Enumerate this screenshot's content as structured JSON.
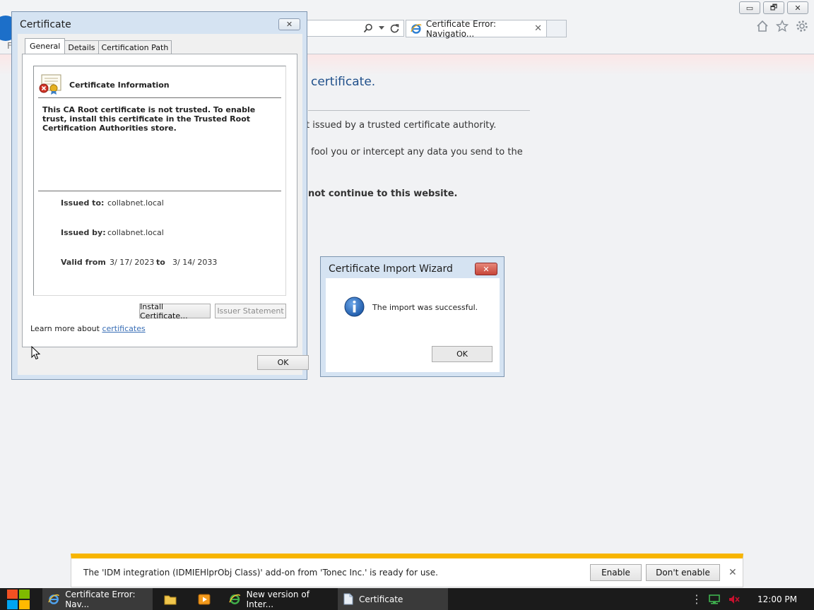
{
  "browser": {
    "active_tab_title": "Certificate Error: Navigatio...",
    "tab_close": "✕",
    "menu_stub": "F",
    "window_controls": {
      "minimize": "▭",
      "restore": "🗗",
      "close": "✕"
    },
    "toolbar_icons": [
      "home-icon",
      "star-icon",
      "gear-icon"
    ]
  },
  "error_page": {
    "title": "certificate.",
    "line1": "t issued by a trusted certificate authority.",
    "line2": "fool you or intercept any data you send to the",
    "line3": "not continue to this website."
  },
  "cert_dialog": {
    "title": "Certificate",
    "close_label": "✕",
    "tabs": [
      {
        "label": "General"
      },
      {
        "label": "Details"
      },
      {
        "label": "Certification Path"
      }
    ],
    "info_heading": "Certificate Information",
    "warning": "This CA Root certificate is not trusted. To enable trust, install this certificate in the Trusted Root Certification Authorities store.",
    "issued_to_label": "Issued to:",
    "issued_to": "collabnet.local",
    "issued_by_label": "Issued by:",
    "issued_by": "collabnet.local",
    "valid_from_label": "Valid from",
    "valid_from": "3/ 17/ 2023",
    "valid_to_label": "to",
    "valid_to": "3/ 14/ 2033",
    "install_button": "Install Certificate...",
    "issuer_button": "Issuer Statement",
    "learn_more_prefix": "Learn more about ",
    "learn_more_link": "certificates",
    "ok_button": "OK"
  },
  "wizard": {
    "title": "Certificate Import Wizard",
    "close_label": "✕",
    "message": "The import was successful.",
    "ok_button": "OK"
  },
  "notification": {
    "text": "The 'IDM integration (IDMIEHlprObj Class)' add-on from 'Tonec Inc.' is ready for use.",
    "enable_button": "Enable",
    "dont_enable_button": "Don't enable",
    "close_label": "✕"
  },
  "taskbar": {
    "items": [
      {
        "label": "Certificate Error: Nav..."
      },
      {
        "label": "New version of Inter..."
      },
      {
        "label": "Certificate"
      }
    ],
    "clock": "12:00 PM"
  },
  "colors": {
    "accent_blue": "#1c6fc9",
    "notification_bar": "#f7b500",
    "wizard_close": "#c6463a",
    "link": "#3a6fb6"
  }
}
